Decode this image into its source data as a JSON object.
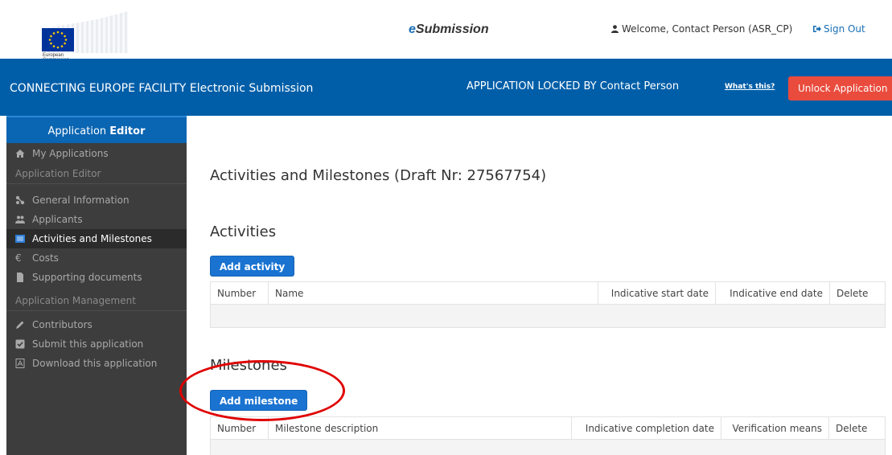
{
  "header": {
    "logo_text": "European Commission",
    "brand_prefix": "e",
    "brand_suffix": "Submission",
    "welcome": "Welcome, Contact Person (ASR_CP)",
    "sign_out": "Sign Out"
  },
  "band": {
    "title": "CONNECTING EUROPE FACILITY Electronic Submission",
    "lock_text": "APPLICATION LOCKED BY Contact Person",
    "whats_this": "What's this?",
    "unlock_label": "Unlock Application"
  },
  "sidebar": {
    "head_normal": "Application",
    "head_bold": "Editor",
    "my_applications": "My Applications",
    "section_editor": "Application Editor",
    "items": [
      {
        "label": "General Information",
        "icon": "share-icon"
      },
      {
        "label": "Applicants",
        "icon": "users-icon"
      },
      {
        "label": "Activities and Milestones",
        "icon": "list-icon"
      },
      {
        "label": "Costs",
        "icon": "euro-icon"
      },
      {
        "label": "Supporting documents",
        "icon": "file-icon"
      }
    ],
    "section_management": "Application Management",
    "management_items": [
      {
        "label": "Contributors",
        "icon": "pencil-icon"
      },
      {
        "label": "Submit this application",
        "icon": "checkbox-icon"
      },
      {
        "label": "Download this application",
        "icon": "pdf-icon"
      }
    ]
  },
  "main": {
    "title": "Activities and Milestones (Draft Nr: 27567754)",
    "activities": {
      "heading": "Activities",
      "add_label": "Add activity",
      "columns": [
        "Number",
        "Name",
        "Indicative start date",
        "Indicative end date",
        "Delete"
      ]
    },
    "milestones": {
      "heading": "Milestones",
      "add_label": "Add milestone",
      "columns": [
        "Number",
        "Milestone description",
        "Indicative completion date",
        "Verification means",
        "Delete"
      ]
    }
  },
  "colors": {
    "band": "#005ea8",
    "unlock": "#e94b3c",
    "primary_button": "#1a73d1",
    "highlight_circle": "#e00000"
  }
}
